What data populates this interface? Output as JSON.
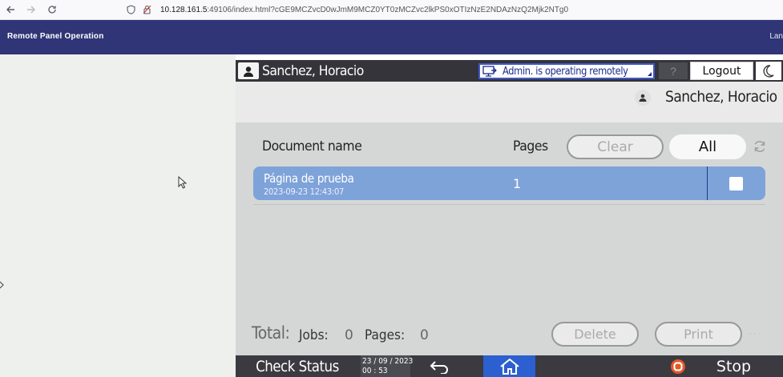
{
  "browser": {
    "url_host": "10.128.161.5",
    "url_rest": ":49106/index.html?cGE9MCZvcD0wJmM9MCZ0YT0zMCZvc2lkPS0xOTIzNzE2NDAzNzQ2Mjk2NTg0"
  },
  "header": {
    "title": "Remote Panel Operation",
    "language": "Lan"
  },
  "device": {
    "top_bar": {
      "user_name": "Sanchez, Horacio",
      "admin_status": "Admin. is operating remotely",
      "help_label": "?",
      "logout_label": "Logout"
    },
    "user_strip": {
      "user_name": "Sanchez, Horacio"
    },
    "list": {
      "col_document": "Document name",
      "col_pages": "Pages",
      "clear_label": "Clear",
      "all_label": "All",
      "jobs": [
        {
          "name": "Página de prueba",
          "datetime": "2023-09-23 12:43:07",
          "pages": "1",
          "selected": false
        }
      ]
    },
    "totals": {
      "total_label": "Total:",
      "jobs_label": "Jobs:",
      "jobs_value": "0",
      "pages_label": "Pages:",
      "pages_value": "0",
      "delete_label": "Delete",
      "print_label": "Print"
    },
    "bottom_bar": {
      "check_status_label": "Check Status",
      "date": "23 / 09 / 2023",
      "time": "00 : 53",
      "stop_label": "Stop"
    }
  },
  "colors": {
    "header_bg": "#2f3576",
    "row_selected": "#7ea3d9",
    "home_button": "#2c5fd0",
    "stop_icon": "#e3572a"
  },
  "icons": [
    "back-arrow-icon",
    "forward-arrow-icon",
    "reload-icon",
    "shield-icon",
    "lock-icon",
    "user-icon",
    "monitor-icon",
    "moon-icon",
    "refresh-icon",
    "return-icon",
    "home-icon",
    "stop-icon",
    "expand-icon",
    "cursor-icon"
  ]
}
